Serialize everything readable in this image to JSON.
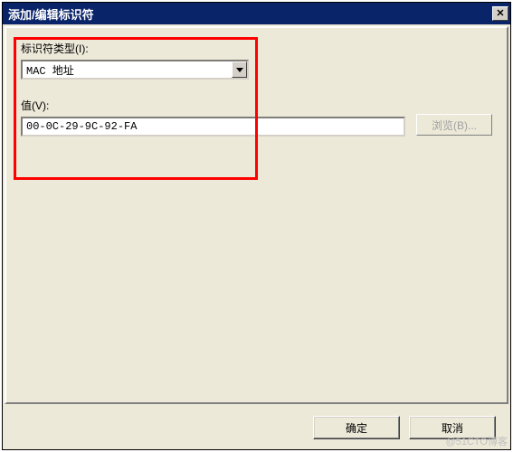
{
  "window": {
    "title": "添加/编辑标识符",
    "close_glyph": "✕"
  },
  "fields": {
    "type_label": "标识符类型(I):",
    "type_value": "MAC 地址",
    "value_label": "值(V):",
    "value_text": "00-0C-29-9C-92-FA",
    "browse_label": "浏览(B)..."
  },
  "buttons": {
    "ok": "确定",
    "cancel": "取消"
  },
  "watermark": "@51CTO博客"
}
